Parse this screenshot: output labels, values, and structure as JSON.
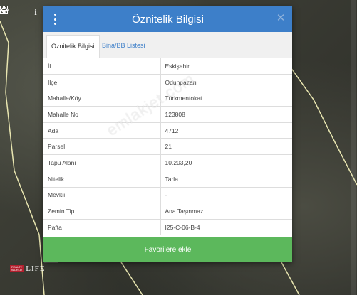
{
  "modal": {
    "title": "Öznitelik Bilgisi",
    "close_glyph": "✕",
    "favorite_button": "Favorilere ekle"
  },
  "tabs": [
    {
      "label": "Öznitelik Bilgisi",
      "active": true
    },
    {
      "label": "Bina/BB Listesi",
      "active": false
    }
  ],
  "attributes": [
    {
      "key": "İl",
      "value": "Eskişehir"
    },
    {
      "key": "İlçe",
      "value": "Odunpazarı"
    },
    {
      "key": "Mahalle/Köy",
      "value": "Türkmentokat"
    },
    {
      "key": "Mahalle No",
      "value": "123808"
    },
    {
      "key": "Ada",
      "value": "4712"
    },
    {
      "key": "Parsel",
      "value": "21"
    },
    {
      "key": "Tapu Alanı",
      "value": "10.203,20"
    },
    {
      "key": "Nitelik",
      "value": "Tarla"
    },
    {
      "key": "Mevkii",
      "value": "-"
    },
    {
      "key": "Zemin Tip",
      "value": "Ana Taşınmaz"
    },
    {
      "key": "Pafta",
      "value": "I25-C-06-B-4"
    }
  ],
  "watermark": "emlakjet.com",
  "logo": {
    "line1": "REALTY",
    "line2": "WORLD",
    "life": "LIFE"
  },
  "icons": {
    "toolbar": [
      "grid-icon",
      "crosshair-icon",
      "info-icon"
    ],
    "menu": "vertical-dots-icon",
    "close": "close-icon"
  },
  "colors": {
    "header": "#3d7fc9",
    "favorite_button": "#5cb85c",
    "parcel_outline": "#e8e5b0"
  }
}
